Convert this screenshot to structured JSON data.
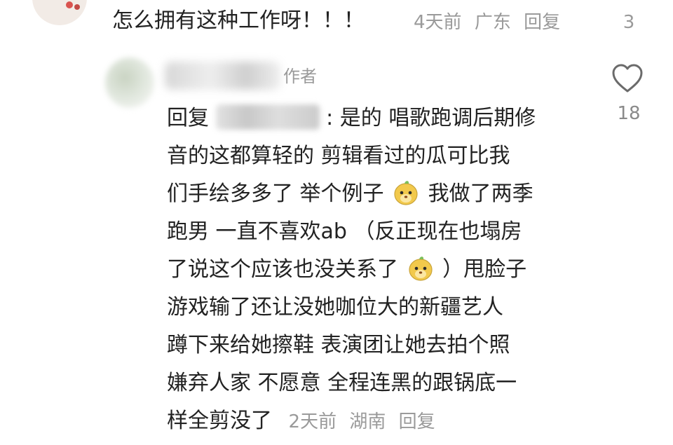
{
  "comment1": {
    "text": "怎么拥有这种工作呀！！！",
    "time": "4天前",
    "location": "广东",
    "reply_label": "回复",
    "likes": "3"
  },
  "comment2": {
    "author_tag": "作者",
    "reply_prefix": "回复",
    "lines": [
      ": 是的 唱歌跑调后期修",
      "音的这都算轻的 剪辑看过的瓜可比我",
      "们手绘多多了  举个例子",
      "我做了两季",
      "跑男 一直不喜欢ab （反正现在也塌房",
      "了说这个应该也没关系了",
      "）甩脸子",
      "游戏输了还让没她咖位大的新疆艺人",
      "蹲下来给她擦鞋 表演团让她去拍个照",
      "嫌弃人家 不愿意 全程连黑的跟锅底一",
      "样全剪没了"
    ],
    "time": "2天前",
    "location": "湖南",
    "reply_label": "回复",
    "likes": "18"
  },
  "colors": {
    "text": "#222222",
    "meta": "#9a9a9a",
    "emoji": "#f2c94c"
  },
  "icons": [
    "heart-icon",
    "emoji-icon"
  ]
}
